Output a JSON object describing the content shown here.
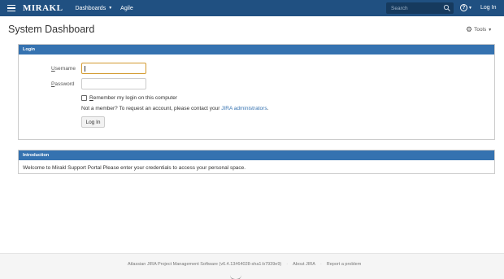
{
  "header": {
    "logo": "MIRAKL",
    "nav_dashboards": "Dashboards",
    "nav_agile": "Agile",
    "search_placeholder": "Search",
    "help_symbol": "?",
    "login_link": "Log In"
  },
  "page": {
    "title": "System Dashboard",
    "tools_label": "Tools"
  },
  "login_panel": {
    "heading": "Login",
    "username_label_first": "U",
    "username_label_rest": "sername",
    "password_label_first": "P",
    "password_label_rest": "assword",
    "username_value": "",
    "password_value": "",
    "remember_first": "R",
    "remember_rest": "emember my login on this computer",
    "remember_checked": false,
    "member_text": "Not a member? To request an account, please contact your ",
    "member_link": "JIRA administrators",
    "member_end": ".",
    "login_button": "Log In"
  },
  "intro_panel": {
    "heading": "Introduction",
    "text": "Welcome to Mirakl Support Portal Please enter your credentials to access your personal space."
  },
  "footer": {
    "software": "Atlassian JIRA Project Management Software (v6.4.13#64028-sha1:b7939e9)",
    "sep1": "·",
    "about": "About JIRA",
    "sep2": "·",
    "report": "Report a problem"
  },
  "colors": {
    "header_bg": "#205081",
    "panel_head_bg": "#3572b0",
    "focus_border": "#d39a2f",
    "link": "#3572b0"
  }
}
